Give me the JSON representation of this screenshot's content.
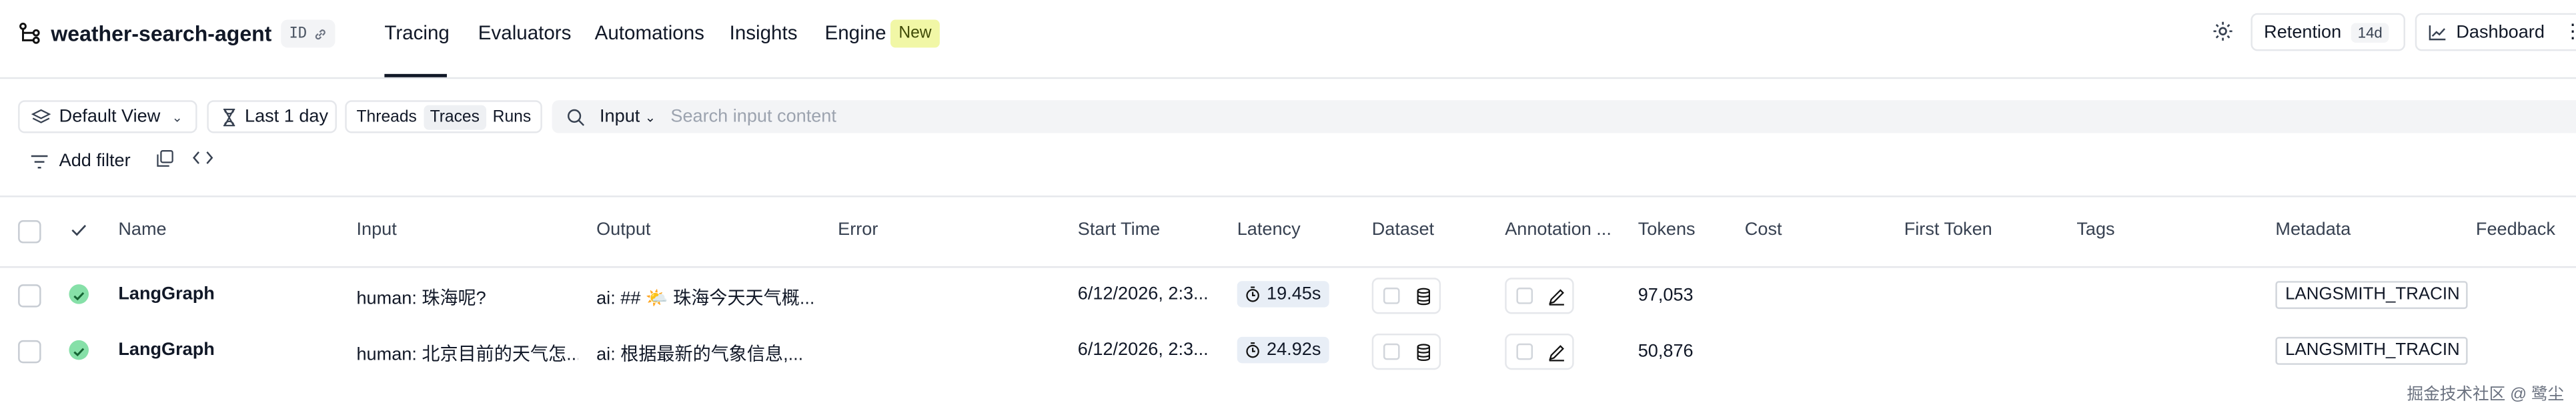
{
  "header": {
    "project_name": "weather-search-agent",
    "id_label": "ID",
    "tabs": [
      {
        "label": "Tracing",
        "active": true
      },
      {
        "label": "Evaluators",
        "active": false
      },
      {
        "label": "Automations",
        "active": false
      },
      {
        "label": "Insights",
        "active": false
      },
      {
        "label": "Engine",
        "active": false
      }
    ],
    "new_badge": "New",
    "retention_label": "Retention",
    "retention_value": "14d",
    "dashboard_label": "Dashboard"
  },
  "toolbar": {
    "view_label": "Default View",
    "time_label": "Last 1 day",
    "segments": [
      "Threads",
      "Traces",
      "Runs"
    ],
    "selected_segment": "Traces",
    "search_field": "Input",
    "search_placeholder": "Search input content",
    "add_filter_label": "Add filter"
  },
  "table": {
    "columns": [
      "Name",
      "Input",
      "Output",
      "Error",
      "Start Time",
      "Latency",
      "Dataset",
      "Annotation ...",
      "Tokens",
      "Cost",
      "First Token",
      "Tags",
      "Metadata",
      "Feedback"
    ],
    "rows": [
      {
        "name": "LangGraph",
        "input": "human: 珠海呢?",
        "output": "ai: ## 🌤️ 珠海今天天气概...",
        "error": "",
        "start_time": "6/12/2026, 2:3...",
        "latency": "19.45s",
        "tokens": "97,053",
        "metadata": "LANGSMITH_TRACIN"
      },
      {
        "name": "LangGraph",
        "input": "human: 北京目前的天气怎...",
        "output": "ai: 根据最新的气象信息,...",
        "error": "",
        "start_time": "6/12/2026, 2:3...",
        "latency": "24.92s",
        "tokens": "50,876",
        "metadata": "LANGSMITH_TRACIN"
      }
    ]
  },
  "watermark": "掘金技术社区 @ 鹭尘",
  "colors": {
    "accent_badge": "#f1f7a6",
    "status_ok": "#86e0a8",
    "latency_bg": "#e8eef6"
  }
}
